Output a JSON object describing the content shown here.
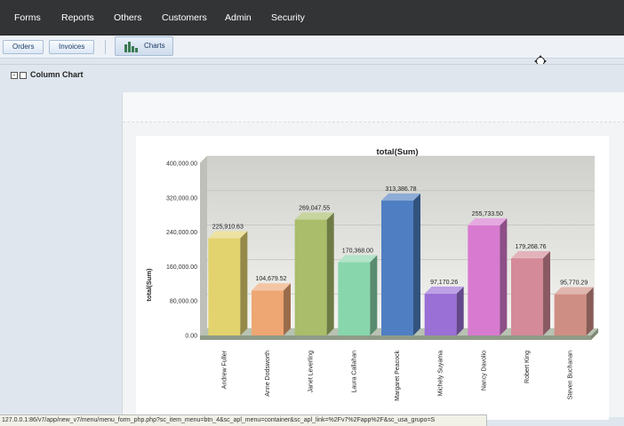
{
  "nav": {
    "items": [
      {
        "label": "Forms"
      },
      {
        "label": "Reports"
      },
      {
        "label": "Others"
      },
      {
        "label": "Customers"
      },
      {
        "label": "Admin"
      },
      {
        "label": "Security"
      }
    ]
  },
  "toolbar": {
    "orders_label": "Orders",
    "invoices_label": "Invoices",
    "charts_label": "Charts"
  },
  "panel": {
    "toggle": "-",
    "title": "Column Chart"
  },
  "status": {
    "url": "127.0.0.1:86/v7/app/new_v7/menu/menu_form_php.php?sc_item_menu=btn_4&sc_apl_menu=container&sc_apl_link=%2Fv7%2Fapp%2F&sc_usa_grupo=S"
  },
  "colors": {
    "nav_bg": "#333436",
    "bar_colors": [
      "#e3d36e",
      "#eea673",
      "#a9bd6a",
      "#88d6ac",
      "#4f7fc2",
      "#9a6fd6",
      "#d77ad0",
      "#d48a98",
      "#cf8e84"
    ]
  },
  "chart_data": {
    "type": "bar",
    "title": "total(Sum)",
    "xlabel": "",
    "ylabel": "total(Sum)",
    "ylim": [
      0,
      400000
    ],
    "yticks": [
      "0.00",
      "80,000.00",
      "160,000.00",
      "240,000.00",
      "320,000.00",
      "400,000.00"
    ],
    "ytick_values": [
      0,
      80000,
      160000,
      240000,
      320000,
      400000
    ],
    "categories": [
      "Andrew Fuller",
      "Anne Dodsworth",
      "Janet Leverling",
      "Laura Callahan",
      "Margaret Peacock",
      "Michely Suyama",
      "Nancy Davolio",
      "Robert King",
      "Steven Buchanan"
    ],
    "values": [
      225910.63,
      104679.52,
      269047.55,
      170368.0,
      313386.78,
      97170.26,
      255733.5,
      179268.76,
      95770.29
    ],
    "value_labels": [
      "225,910.63",
      "104,679.52",
      "269,047.55",
      "170,368.00",
      "313,386.78",
      "97,170.26",
      "255,733.50",
      "179,268.76",
      "95,770.29"
    ],
    "grid": true,
    "legend": "none"
  }
}
